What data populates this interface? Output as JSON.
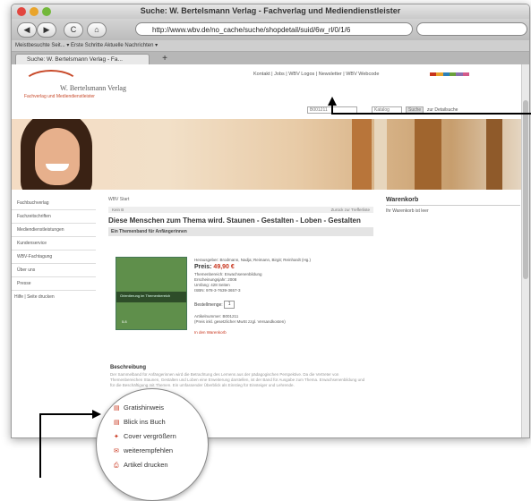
{
  "window": {
    "title": "Suche: W. Bertelsmann Verlag - Fachverlag und Mediendienstleister"
  },
  "toolbar": {
    "back": "◀",
    "forward": "▶",
    "reload": "C",
    "home": "⌂",
    "address": "http://www.wbv.de/no_cache/suche/shopdetail/suid/6w_rl/0/1/6",
    "search_value": ""
  },
  "bookmarks": {
    "text": "Meistbesuchte Seit... ▾   Erste Schritte   Aktuelle Nachrichten ▾"
  },
  "tab": {
    "label": "Suche: W. Bertelsmann Verlag - Fa...",
    "new": "+"
  },
  "header": {
    "logo_name": "W. Bertelsmann Verlag",
    "logo_sub": "Fachverlag und Mediendienstleister",
    "toplinks": "Kontakt | Jobs | WBV Logos | Newsletter | WBV Webcode",
    "colors": [
      "#c8341c",
      "#e9a42b",
      "#2b7fb8",
      "#6aa13b",
      "#8a6fb0",
      "#d35a8a"
    ],
    "search_value": "B001211",
    "search_select": "Katalog",
    "search_btn": "Suche",
    "detail_link": "zur Detailsuche"
  },
  "sidebar": {
    "items": [
      "Fachbuchverlag",
      "Fachzeitschriften",
      "Mediendienstleistungen",
      "Kundenservice",
      "WBV-Fachtagung",
      "Über uns",
      "Presse"
    ],
    "footer": "Hilfe | Seite drucken"
  },
  "content": {
    "crumb": "WBV Start",
    "bar_left": "Kein B",
    "bar_mid": "",
    "bar_right": "Zurück zur Trefferliste",
    "title": "Diese Menschen zum Thema wird. Staunen - Gestalten - Loben - Gestalten",
    "subtitle": "Ein Themenband für Anfängerinnen",
    "book_label": "Orientierung im Themenbereich",
    "book_num": "5.8",
    "authors": "Herausgeber: Brodmann, Nadja; Reimann, Birgit; Reinhardt (Hg.)",
    "price_label": "Preis:",
    "price": "49,90 €",
    "meta": [
      "Themenbereich: Erwachsenenbildung",
      "Erscheinungsjahr: 2008",
      "Umfang: 428 Seiten",
      "ISBN: 978-3-7639-3657-3"
    ],
    "qty_label": "Bestellmenge:",
    "qty": "1",
    "article": "Artikelnummer: B001211",
    "note": "(Preis inkl. gesetzlicher MwSt zzgl. Versandkosten)",
    "cart": "In den Warenkorb",
    "desc_head": "Beschreibung",
    "desc": "Der Sammelband für Anfängerinnen wird die Betrachtung des Lernens aus der pädagogischen Perspektive. Da die Vertreter von Themenbereichen Staunen, Gestalten und Loben eine Erweiterung darstellen, ist der Band für Ausgabe zum Thema. Erwachsenenbildung und für die Beschäftigung mit Themen. Ein umfassender Überblick als Einstieg für Einsteiger und Lehrende."
  },
  "cart_widget": {
    "head": "Warenkorb",
    "text": "Ihr Warenkorb ist leer"
  },
  "magnifier": {
    "items": [
      {
        "icon": "▤",
        "label": "Gratishinweis"
      },
      {
        "icon": "▤",
        "label": "Blick ins Buch"
      },
      {
        "icon": "✦",
        "label": "Cover vergrößern"
      },
      {
        "icon": "✉",
        "label": "weiterempfehlen"
      },
      {
        "icon": "⎙",
        "label": "Artikel drucken"
      }
    ]
  }
}
